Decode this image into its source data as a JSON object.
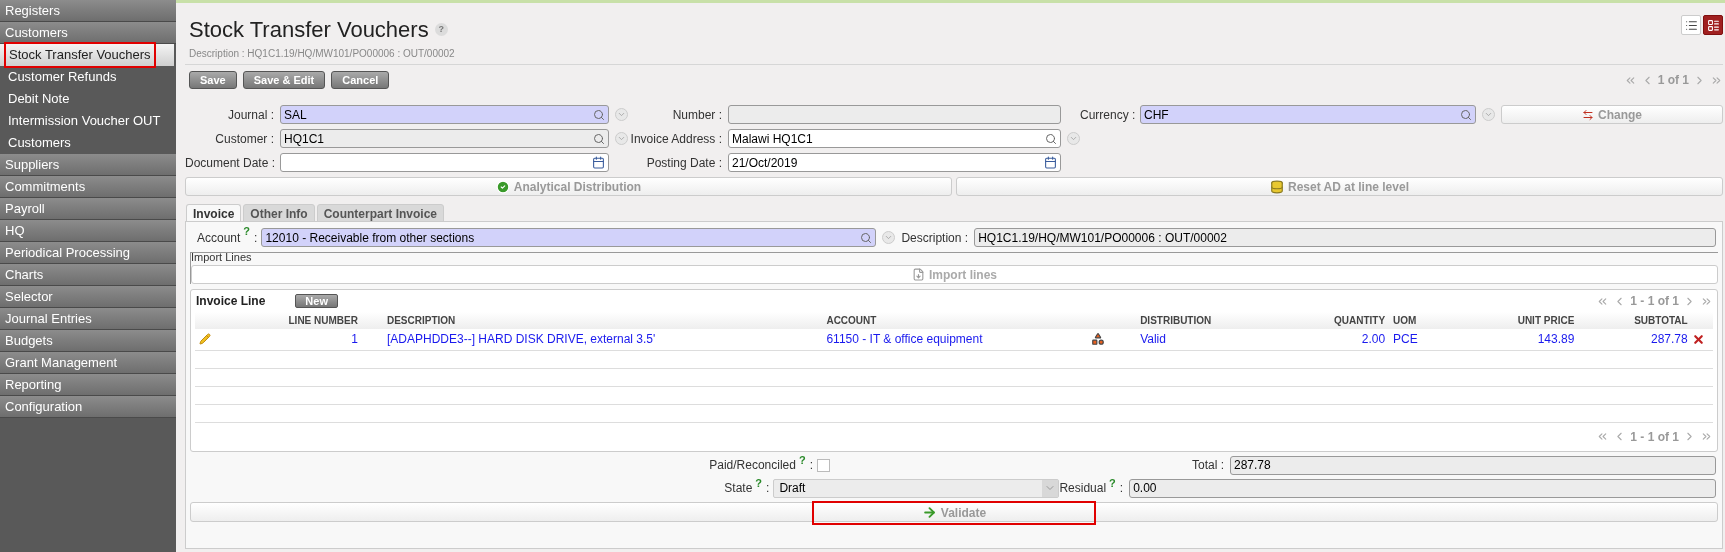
{
  "sidebar": {
    "items": [
      {
        "label": "Registers",
        "kind": "section",
        "selected": false,
        "highlighted": false
      },
      {
        "label": "Customers",
        "kind": "section",
        "selected": false,
        "highlighted": false
      },
      {
        "label": "Stock Transfer Vouchers",
        "kind": "item",
        "selected": true,
        "highlighted": true
      },
      {
        "label": "Customer Refunds",
        "kind": "item",
        "selected": false,
        "highlighted": false
      },
      {
        "label": "Debit Note",
        "kind": "item",
        "selected": false,
        "highlighted": false
      },
      {
        "label": "Intermission Voucher OUT",
        "kind": "item",
        "selected": false,
        "highlighted": false
      },
      {
        "label": "Customers",
        "kind": "item",
        "selected": false,
        "highlighted": false
      },
      {
        "label": "Suppliers",
        "kind": "section",
        "selected": false,
        "highlighted": false
      },
      {
        "label": "Commitments",
        "kind": "section",
        "selected": false,
        "highlighted": false
      },
      {
        "label": "Payroll",
        "kind": "section",
        "selected": false,
        "highlighted": false
      },
      {
        "label": "HQ",
        "kind": "section",
        "selected": false,
        "highlighted": false
      },
      {
        "label": "Periodical Processing",
        "kind": "section",
        "selected": false,
        "highlighted": false
      },
      {
        "label": "Charts",
        "kind": "section",
        "selected": false,
        "highlighted": false
      },
      {
        "label": "Selector",
        "kind": "section",
        "selected": false,
        "highlighted": false
      },
      {
        "label": "Journal Entries",
        "kind": "section",
        "selected": false,
        "highlighted": false
      },
      {
        "label": "Budgets",
        "kind": "section",
        "selected": false,
        "highlighted": false
      },
      {
        "label": "Grant Management",
        "kind": "section",
        "selected": false,
        "highlighted": false
      },
      {
        "label": "Reporting",
        "kind": "section",
        "selected": false,
        "highlighted": false
      },
      {
        "label": "Configuration",
        "kind": "section",
        "selected": false,
        "highlighted": false
      }
    ]
  },
  "header": {
    "title": "Stock Transfer Vouchers",
    "help": "?",
    "description": "Description : HQ1C1.19/HQ/MW101/PO00006 : OUT/00002",
    "view_buttons": [
      {
        "kind": "list",
        "selected": false
      },
      {
        "kind": "form",
        "selected": true
      }
    ]
  },
  "toolbar": {
    "buttons": [
      "Save",
      "Save & Edit",
      "Cancel"
    ],
    "pager": "1 of 1"
  },
  "form": {
    "rows": [
      [
        {
          "label": "Journal :",
          "value": "SAL",
          "kind": "search",
          "required": true
        },
        {
          "label": "Number :",
          "kind": "readonly",
          "required": false
        },
        {
          "label": "Currency :",
          "value": "CHF",
          "kind": "search",
          "required": true
        }
      ],
      [
        {
          "label": "Customer :",
          "value": "HQ1C1",
          "kind": "readonly-search",
          "required": false
        },
        {
          "label": "Invoice Address :",
          "value": "Malawi HQ1C1",
          "kind": "search",
          "required": false
        }
      ],
      [
        {
          "label": "Document Date :",
          "kind": "date",
          "required": false
        },
        {
          "label": "Posting Date :",
          "value": "21/Oct/2019",
          "kind": "date",
          "required": false
        }
      ]
    ],
    "change_button": "Change",
    "analytical_button": "Analytical Distribution",
    "reset_button": "Reset AD at line level"
  },
  "tabs": [
    {
      "label": "Invoice",
      "selected": true
    },
    {
      "label": "Other Info",
      "selected": false
    },
    {
      "label": "Counterpart Invoice",
      "selected": false
    }
  ],
  "invoice": {
    "account_label": "Account",
    "account_help": "?",
    "account_colon": ":",
    "account": "12010 - Receivable from other sections",
    "description_label": "Description :",
    "description": "HQ1C1.19/HQ/MW101/PO00006 : OUT/00002",
    "import_legend": "Import Lines",
    "import_button": "Import lines",
    "lines": {
      "title": "Invoice Line",
      "new_button": "New",
      "pager": "1 - 1 of 1",
      "pager_bottom": "1 - 1 of 1",
      "columns": [
        "LINE NUMBER",
        "DESCRIPTION",
        "ACCOUNT",
        "DISTRIBUTION",
        "QUANTITY",
        "UOM",
        "UNIT PRICE",
        "SUBTOTAL"
      ],
      "rows": [
        {
          "line_number": "1",
          "description": "[ADAPHDDE3--] HARD DISK DRIVE, external 3.5'",
          "account": "61150 - IT & office equipment",
          "distribution": "Valid",
          "quantity": "2.00",
          "uom": "PCE",
          "unit_price": "143.89",
          "subtotal": "287.78"
        }
      ]
    },
    "paid_label": "Paid/Reconciled",
    "paid_help": "?",
    "paid_colon": ":",
    "paid": false,
    "total_label": "Total :",
    "total": "287.78",
    "state_label": "State",
    "state_help": "?",
    "state_colon": ":",
    "state": "Draft",
    "residual_label": "Residual",
    "residual_help": "?",
    "residual_colon": ":",
    "residual": "0.00",
    "validate_button": "Validate",
    "validate_highlighted": true
  }
}
